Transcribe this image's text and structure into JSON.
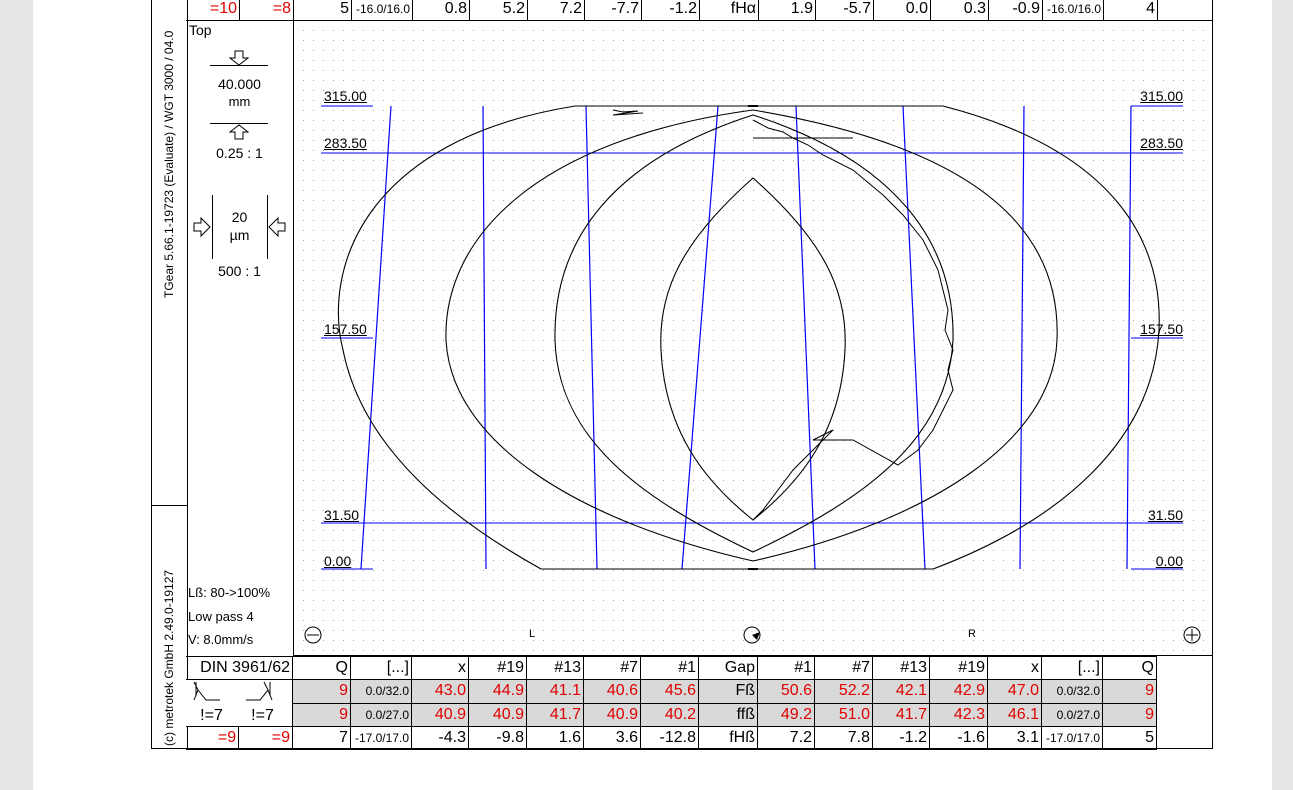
{
  "sidebar": {
    "software_text": "TGear 5.66.1-19723 (Evaluate) / WGT 3000 / 04.0",
    "copyright_text": "(c) metrotek GmbH 2.49.0-19127"
  },
  "top_row": {
    "left_a": "=10",
    "left_b": "=8",
    "cells": [
      "5",
      "-16.0/16.0",
      "0.8",
      "5.2",
      "7.2",
      "-7.7",
      "-1.2",
      "fHα",
      "1.9",
      "-5.7",
      "0.0",
      "0.3",
      "-0.9",
      "-16.0/16.0",
      "4"
    ]
  },
  "left_panel": {
    "top_label": "Top",
    "length_value": "40.000",
    "length_unit": "mm",
    "length_ratio": "0.25 : 1",
    "micron_value": "20",
    "micron_unit": "µm",
    "micron_ratio": "500 : 1",
    "lb_text": "Lß: 80->100%",
    "lowpass_text": "Low pass 4",
    "speed_text": "V: 8.0mm/s"
  },
  "plot": {
    "y_labels": [
      "315.00",
      "283.50",
      "157.50",
      "31.50",
      "0.00"
    ],
    "left_marker": "L",
    "right_marker": "R",
    "line_color": "#0000ff"
  },
  "table": {
    "standard": "DIN 3961/62",
    "headers": [
      "Q",
      "[...]",
      "x",
      "#19",
      "#13",
      "#7",
      "#1",
      "Gap",
      "#1",
      "#7",
      "#13",
      "#19",
      "x",
      "[...]",
      "Q"
    ],
    "rows": [
      [
        "9",
        "0.0/32.0",
        "43.0",
        "44.9",
        "41.1",
        "40.6",
        "45.6",
        "Fß",
        "50.6",
        "52.2",
        "42.1",
        "42.9",
        "47.0",
        "0.0/32.0",
        "9"
      ],
      [
        "9",
        "0.0/27.0",
        "40.9",
        "40.9",
        "41.7",
        "40.9",
        "40.2",
        "ffß",
        "49.2",
        "51.0",
        "41.7",
        "42.3",
        "46.1",
        "0.0/27.0",
        "9"
      ],
      [
        "7",
        "-17.0/17.0",
        "-4.3",
        "-9.8",
        "1.6",
        "3.6",
        "-12.8",
        "fHß",
        "7.2",
        "7.8",
        "-1.2",
        "-1.6",
        "3.1",
        "-17.0/17.0",
        "5"
      ]
    ],
    "left_marks": {
      "m1": "!=7",
      "m2": "!=7",
      "m3": "=9",
      "m4": "=9"
    },
    "accent_color": "#e00000"
  }
}
